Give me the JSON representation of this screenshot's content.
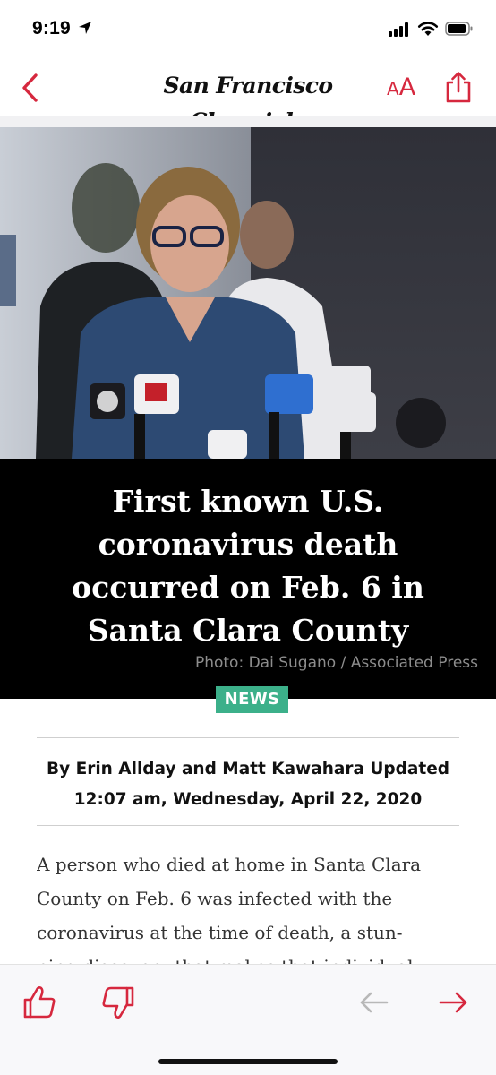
{
  "status_bar": {
    "time": "9:19"
  },
  "header": {
    "masthead": "San Francisco Chronicle",
    "font_size_small": "A",
    "font_size_large": "A"
  },
  "article": {
    "headline": "First known U.S. coronavirus death occurred on Feb. 6 in Santa Clara County",
    "photo_credit": "Photo: Dai Sugano / Associated Press",
    "section": "NEWS",
    "byline_line1": "By Erin Allday and Matt Kawahara Updated",
    "byline_line2": "12:07 am, Wednesday, April 22, 2020",
    "body_line1": "A person who died at home in Santa Clara",
    "body_line2": "County on Feb. 6 was infected with the",
    "body_line3": "coronavirus at the time of death, a stun-",
    "body_line4": "ning discovery that makes that individual"
  },
  "icons": {
    "back": "chevron-left-icon",
    "share": "share-icon",
    "like": "thumbs-up-icon",
    "dislike": "thumbs-down-icon",
    "previous": "arrow-left-icon",
    "next": "arrow-right-icon"
  },
  "colors": {
    "accent": "#d6283e",
    "section_tag": "#3cb08a",
    "headline_bg": "#000000",
    "disabled_arrow": "#b8b8b8"
  }
}
